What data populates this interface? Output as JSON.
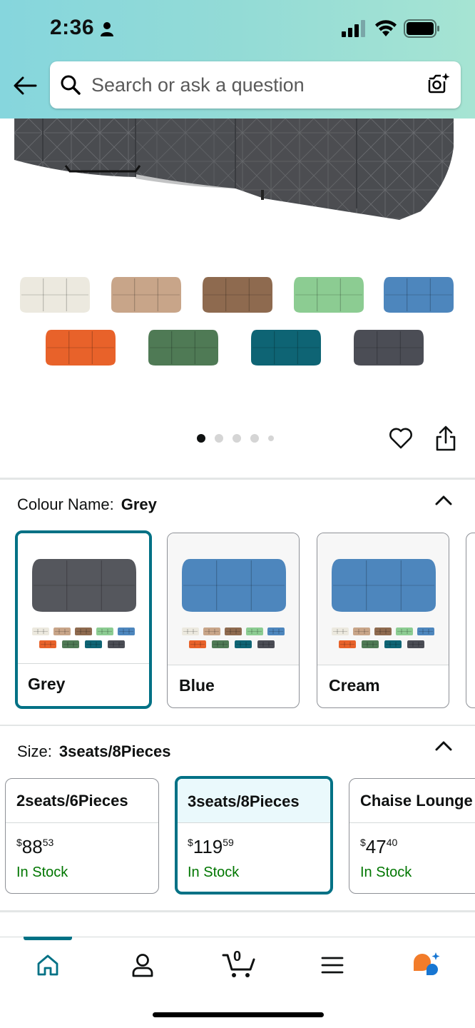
{
  "status_bar": {
    "time": "2:36"
  },
  "search": {
    "placeholder": "Search or ask a question"
  },
  "gallery": {
    "swatch_colors": [
      "#ece9df",
      "#c8a589",
      "#8e6a4f",
      "#8ccc92",
      "#4d86bd",
      "#e8622a",
      "#4f7a55",
      "#0e6474",
      "#4b4d55"
    ],
    "product_color": "#4a4c50",
    "page_count": 5,
    "active_page": 1
  },
  "colour": {
    "label": "Colour Name:",
    "selected": "Grey",
    "options": [
      {
        "name": "Grey",
        "sofa_color": "#55575d",
        "selected": true
      },
      {
        "name": "Blue",
        "sofa_color": "#4d86bd",
        "selected": false
      },
      {
        "name": "Cream",
        "sofa_color": "#4d86bd",
        "selected": false
      }
    ]
  },
  "size": {
    "label": "Size:",
    "selected": "3seats/8Pieces",
    "options": [
      {
        "name": "2seats/6Pieces",
        "price_dollars": "88",
        "price_cents": "53",
        "stock": "In Stock",
        "selected": false
      },
      {
        "name": "3seats/8Pieces",
        "price_dollars": "119",
        "price_cents": "59",
        "stock": "In Stock",
        "selected": true
      },
      {
        "name": "Chaise Lounge",
        "price_dollars": "47",
        "price_cents": "40",
        "stock": "In Stock",
        "selected": false
      }
    ],
    "currency": "$"
  },
  "nav": {
    "cart_count": "0",
    "active": "home"
  },
  "colors": {
    "accent": "#007185",
    "stock_green": "#007600",
    "header_start": "#86d6dd",
    "header_end": "#a6e4d3"
  }
}
